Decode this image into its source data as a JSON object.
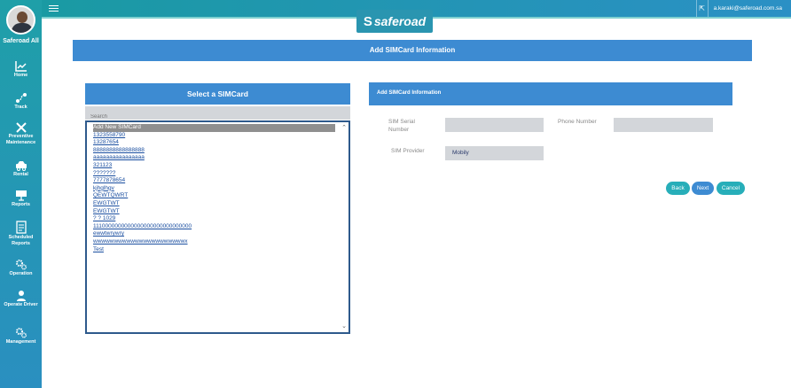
{
  "sidebar": {
    "user_name": "Saferoad All",
    "items": [
      {
        "label": "Home",
        "icon": "chart-icon"
      },
      {
        "label": "Track",
        "icon": "route-icon"
      },
      {
        "label": "Preventive Maintenance",
        "icon": "tools-icon"
      },
      {
        "label": "Rental",
        "icon": "car-icon"
      },
      {
        "label": "Reports",
        "icon": "presentation-icon"
      },
      {
        "label": "Scheduled Reports",
        "icon": "schedule-report-icon"
      },
      {
        "label": "Operation",
        "icon": "gears-icon"
      },
      {
        "label": "Operate Driver",
        "icon": "driver-icon"
      },
      {
        "label": "Management",
        "icon": "gears-icon"
      }
    ]
  },
  "topbar": {
    "email": "a.karaki@saferoad.com.sa",
    "logout_glyph": "⇱"
  },
  "logo": {
    "text": "saferoad",
    "mark": "S"
  },
  "page": {
    "title": "Add SIMCard Information"
  },
  "sim_panel": {
    "title": "Select a SIMCard",
    "search_placeholder": "Search",
    "items": [
      "Add New SIMCard",
      "1323558790",
      "13287654",
      "8888888888888888",
      "aaaaaaaaaaaaaaaa",
      "321123",
      "???????",
      "7777878654",
      "kjhglhgv",
      "QEWTQWRT",
      "EWGTWT",
      "EWGTWT",
      "? ? 1029",
      "1110000000000000000000000000000",
      "ewwtwrywry",
      "wwwwwwwwwwwwwwwwwwwwwwx",
      "Test"
    ],
    "selected_index": 0
  },
  "form": {
    "title": "Add SIMCard Information",
    "serial_label_line1": "SIM Serial",
    "serial_label_line2": "Number",
    "serial_value": "",
    "phone_label": "Phone Number",
    "phone_value": "",
    "provider_label": "SIM Provider",
    "provider_value": "Mobily"
  },
  "buttons": {
    "back": "Back",
    "next": "Next",
    "cancel": "Cancel"
  },
  "colors": {
    "header_blue": "#3d8bd2",
    "sidebar_teal": "#1f9fa8",
    "button_teal": "#27aeb9",
    "button_blue": "#3d8bd2"
  }
}
